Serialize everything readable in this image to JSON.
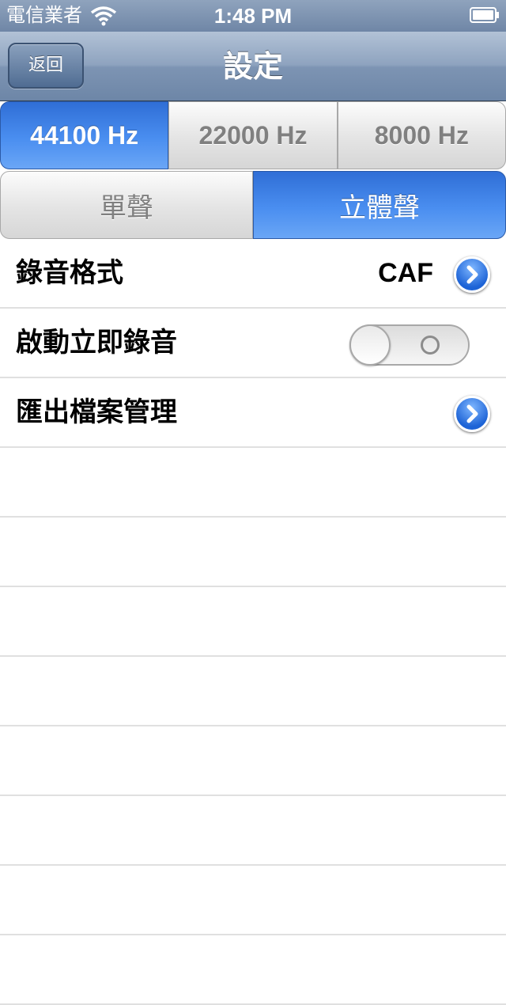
{
  "status_bar": {
    "carrier": "電信業者",
    "time": "1:48 PM"
  },
  "nav": {
    "back_label": "返回",
    "title": "設定"
  },
  "sample_rate": {
    "options": [
      "44100 Hz",
      "22000 Hz",
      "8000 Hz"
    ],
    "selected": "44100 Hz"
  },
  "channel": {
    "options": [
      "單聲",
      "立體聲"
    ],
    "selected": "立體聲"
  },
  "rows": {
    "format": {
      "label": "錄音格式",
      "value": "CAF"
    },
    "auto_record": {
      "label": "啟動立即錄音",
      "state": "off"
    },
    "export": {
      "label": "匯出檔案管理"
    }
  },
  "colors": {
    "accent": "#4a8ef0",
    "nav": "#7d94b3"
  }
}
